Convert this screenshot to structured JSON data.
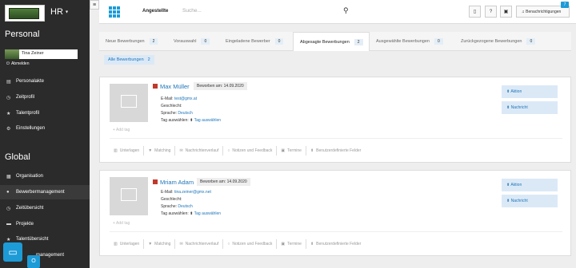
{
  "sidebar": {
    "company": "HR",
    "section_personal": "Personal",
    "user_name": "Tina Zeiner",
    "logout": "Abmelden",
    "personal_items": [
      {
        "label": "Personalakte",
        "icon": "id-card-icon"
      },
      {
        "label": "Zeitprofil",
        "icon": "clock-icon"
      },
      {
        "label": "Talentprofil",
        "icon": "star-icon"
      },
      {
        "label": "Einstellungen",
        "icon": "gear-icon"
      }
    ],
    "section_global": "Global",
    "global_items": [
      {
        "label": "Organisation",
        "icon": "building-icon"
      },
      {
        "label": "Bewerbermanagement",
        "icon": "user-icon"
      },
      {
        "label": "Zeitübersicht",
        "icon": "clock-icon"
      },
      {
        "label": "Projekte",
        "icon": "folder-icon"
      },
      {
        "label": "Talentübersicht",
        "icon": "star-icon"
      },
      {
        "label": "...management",
        "icon": "chart-icon"
      }
    ]
  },
  "topbar": {
    "title": "Angestellte",
    "search_placeholder": "Suche...",
    "notifications_label": "Benachrichtigungen",
    "notifications_count": "7"
  },
  "tabs": [
    {
      "label": "Neue Bewerbungen",
      "count": "2"
    },
    {
      "label": "Vorauswahl",
      "count": "0"
    },
    {
      "label": "Eingeladene Bewerber",
      "count": "0"
    },
    {
      "label": "Abgesagte Bewerbungen",
      "count": "2"
    },
    {
      "label": "Ausgewählte Bewerbungen",
      "count": "0"
    },
    {
      "label": "Zurückgezogene Bewerbungen",
      "count": "0"
    }
  ],
  "all_tab": {
    "label": "Alle Bewerbungen",
    "count": "2"
  },
  "labels": {
    "email": "E-Mail:",
    "gender": "Geschlecht:",
    "language": "Sprache:",
    "tag_select": "Tag auswählen:",
    "tag_select_link": "Tag auswählen",
    "add_tag": "Add tag",
    "action": "Aktion",
    "message": "Nachricht"
  },
  "actions": [
    "Unterlagen",
    "Matching",
    "Nachrichtenverlauf",
    "Notizen und Feedback",
    "Termine",
    "Benutzerdefinierte Felder"
  ],
  "candidates": [
    {
      "name": "Max Müller",
      "applied": "Beworben am: 14.09.2020",
      "email": "test@gmx.at",
      "gender": "",
      "language": "Deutsch"
    },
    {
      "name": "Mriam Adam",
      "applied": "Beworben am: 14.09.2020",
      "email": "tina.zeiner@gmx.net",
      "gender": "",
      "language": "Deutsch"
    }
  ],
  "colors": {
    "accent": "#1d9bd7",
    "sidebar": "#2b2b2b",
    "status": "#c0392b"
  }
}
